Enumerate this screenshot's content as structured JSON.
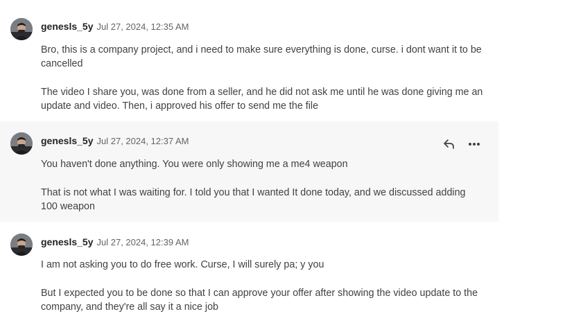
{
  "messages": [
    {
      "username": "genesls_5y",
      "timestamp": "Jul 27, 2024, 12:35 AM",
      "paragraphs": [
        "Bro, this is a company project, and i need to make sure everything is done, curse. i dont want it to be cancelled",
        "The video I share you, was done from a seller, and he did not ask me until he was done giving me an update and video. Then, i approved his offer to send me the file"
      ]
    },
    {
      "username": "genesls_5y",
      "timestamp": "Jul 27, 2024, 12:37 AM",
      "paragraphs": [
        "You haven't done anything. You were only showing me a me4 weapon",
        "That is not what I was waiting for. I told you that I wanted It done today, and we discussed adding 100 weapon"
      ],
      "actions": [
        "reply-icon",
        "more-options-icon"
      ]
    },
    {
      "username": "genesls_5y",
      "timestamp": "Jul 27, 2024, 12:39 AM",
      "paragraphs": [
        "I am not asking you to do free work. Curse, I will surely pa; y you",
        "But I expected you to be done so that I can approve your offer after showing the video update to the company, and they're all say it a nice job"
      ]
    }
  ],
  "colors": {
    "hover_background": "#f7f7f7",
    "username": "#222325",
    "body_text": "#404145",
    "timestamp": "#62646a"
  }
}
